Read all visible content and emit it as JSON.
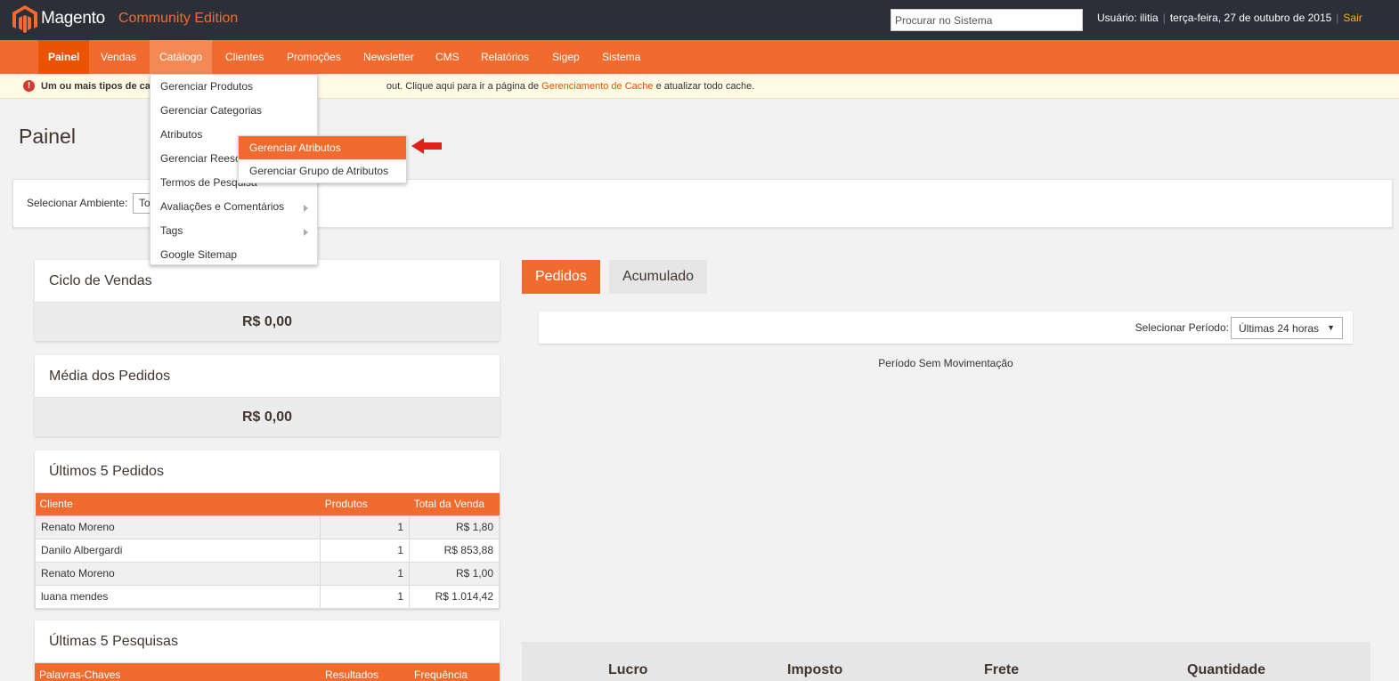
{
  "header": {
    "brand": "Magento",
    "edition": "Community Edition",
    "search_placeholder": "Procurar no Sistema",
    "user_label": "Usuário: ilitia",
    "date": "terça-feira, 27 de outubro de 2015",
    "logout": "Sair"
  },
  "nav": [
    "Painel",
    "Vendas",
    "Catálogo",
    "Clientes",
    "Promoções",
    "Newsletter",
    "CMS",
    "Relatórios",
    "Sigep",
    "Sistema"
  ],
  "notice": {
    "bold": "Um ou mais tipos de ca",
    "text": "out. Clique aqui para ir a página de ",
    "link": "Gerenciamento de Cache",
    "tail": " e atualizar todo cache."
  },
  "page": {
    "title": "Painel"
  },
  "scope": {
    "label": "Selecionar Ambiente:",
    "value": "To"
  },
  "catalog_menu": [
    "Gerenciar Produtos",
    "Gerenciar Categorias",
    "Atributos",
    "Gerenciar Reesc",
    "Termos de Pesquisa",
    "Avaliações e Comentários",
    "Tags",
    "Google Sitemap"
  ],
  "attributes_submenu": [
    "Gerenciar Atributos",
    "Gerenciar Grupo de Atributos"
  ],
  "lifetime_sales": {
    "title": "Ciclo de Vendas",
    "value": "R$ 0,00"
  },
  "average_order": {
    "title": "Média dos Pedidos",
    "value": "R$ 0,00"
  },
  "last_orders": {
    "title": "Últimos 5 Pedidos",
    "columns": [
      "Cliente",
      "Produtos",
      "Total da Venda"
    ],
    "rows": [
      [
        "Renato Moreno",
        "1",
        "R$ 1,80"
      ],
      [
        "Danilo Albergardi",
        "1",
        "R$ 853,88"
      ],
      [
        "Renato Moreno",
        "1",
        "R$ 1,00"
      ],
      [
        "luana mendes",
        "1",
        "R$ 1.014,42"
      ]
    ]
  },
  "last_searches": {
    "title": "Últimas 5 Pesquisas",
    "columns": [
      "Palavras-Chaves",
      "Resultados",
      "Frequência"
    ]
  },
  "tabs": [
    "Pedidos",
    "Acumulado"
  ],
  "period": {
    "label": "Selecionar Período:",
    "value": "Últimas 24 horas"
  },
  "empty_message": "Período Sem Movimentação",
  "totals": [
    "Lucro",
    "Imposto",
    "Frete",
    "Quantidade"
  ]
}
